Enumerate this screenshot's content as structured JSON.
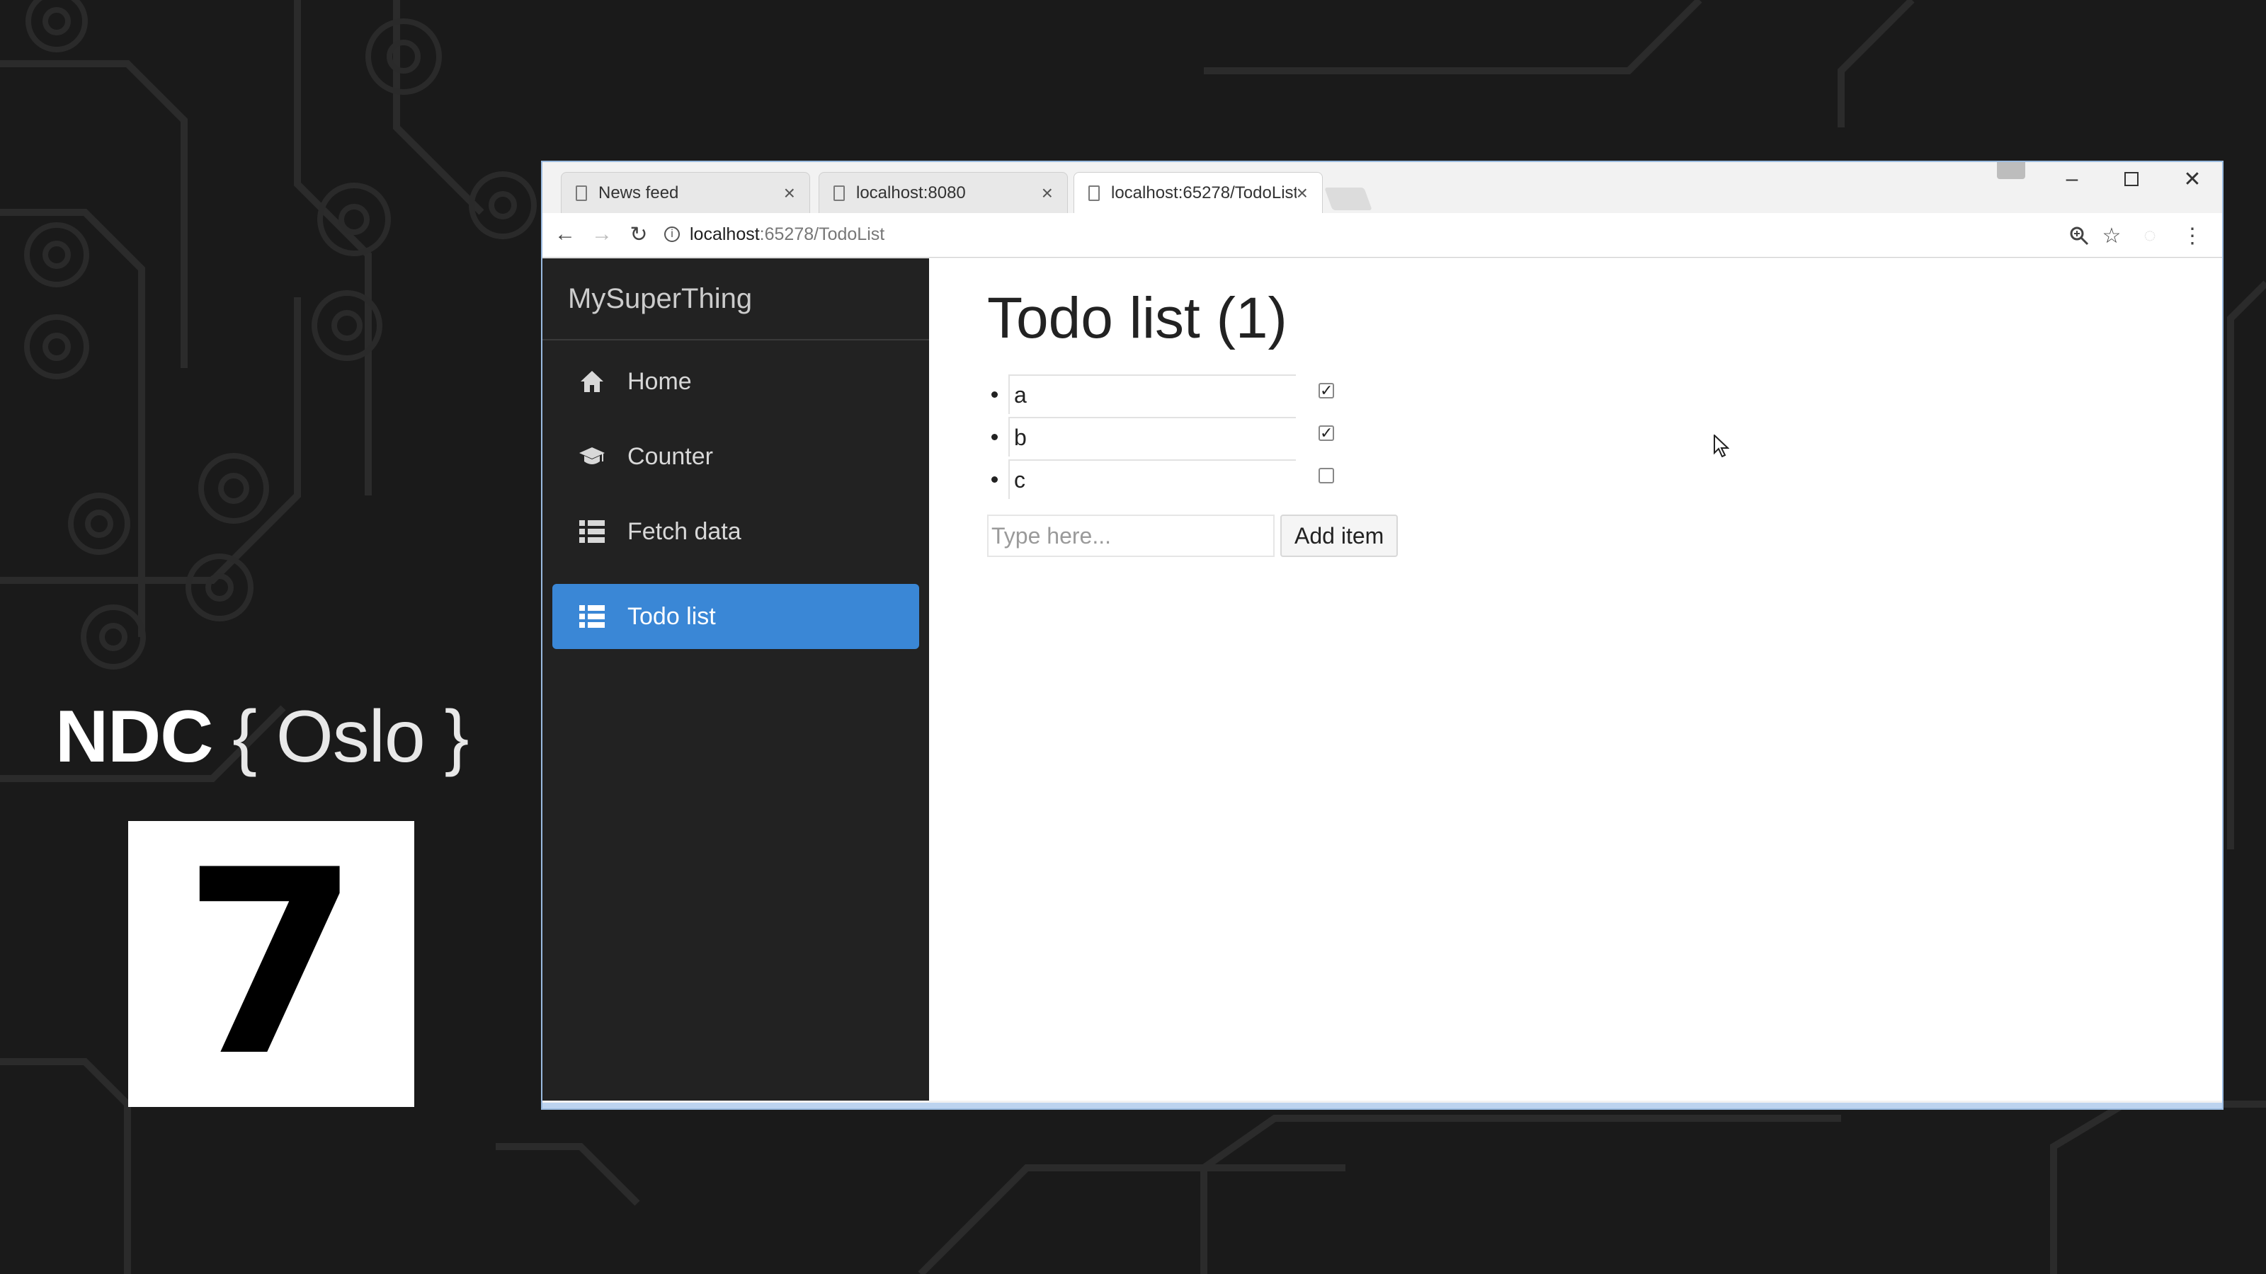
{
  "event": {
    "brand": "NDC",
    "city_open": "{ Oslo }",
    "number": "7"
  },
  "browser": {
    "tabs": [
      {
        "label": "News feed",
        "icon": "page-icon",
        "close": "×"
      },
      {
        "label": "localhost:8080",
        "icon": "page-icon",
        "close": "×"
      },
      {
        "label": "localhost:65278/TodoList",
        "icon": "page-icon",
        "close": "×"
      }
    ],
    "address": {
      "host": "localhost",
      "path": ":65278/TodoList"
    }
  },
  "app": {
    "brand": "MySuperThing",
    "nav": [
      {
        "label": "Home",
        "icon": "home-icon"
      },
      {
        "label": "Counter",
        "icon": "graduation-cap-icon"
      },
      {
        "label": "Fetch data",
        "icon": "list-icon"
      },
      {
        "label": "Todo list",
        "icon": "list-icon",
        "active": true
      }
    ],
    "title": "Todo list (1)",
    "todos": [
      {
        "text": "a",
        "done": true
      },
      {
        "text": "b",
        "done": true
      },
      {
        "text": "c",
        "done": false
      }
    ],
    "new_item": {
      "placeholder": "Type here...",
      "button": "Add item"
    }
  },
  "colors": {
    "accent": "#3a87d6",
    "sidebar": "#222222",
    "background": "#1a1a1a"
  }
}
